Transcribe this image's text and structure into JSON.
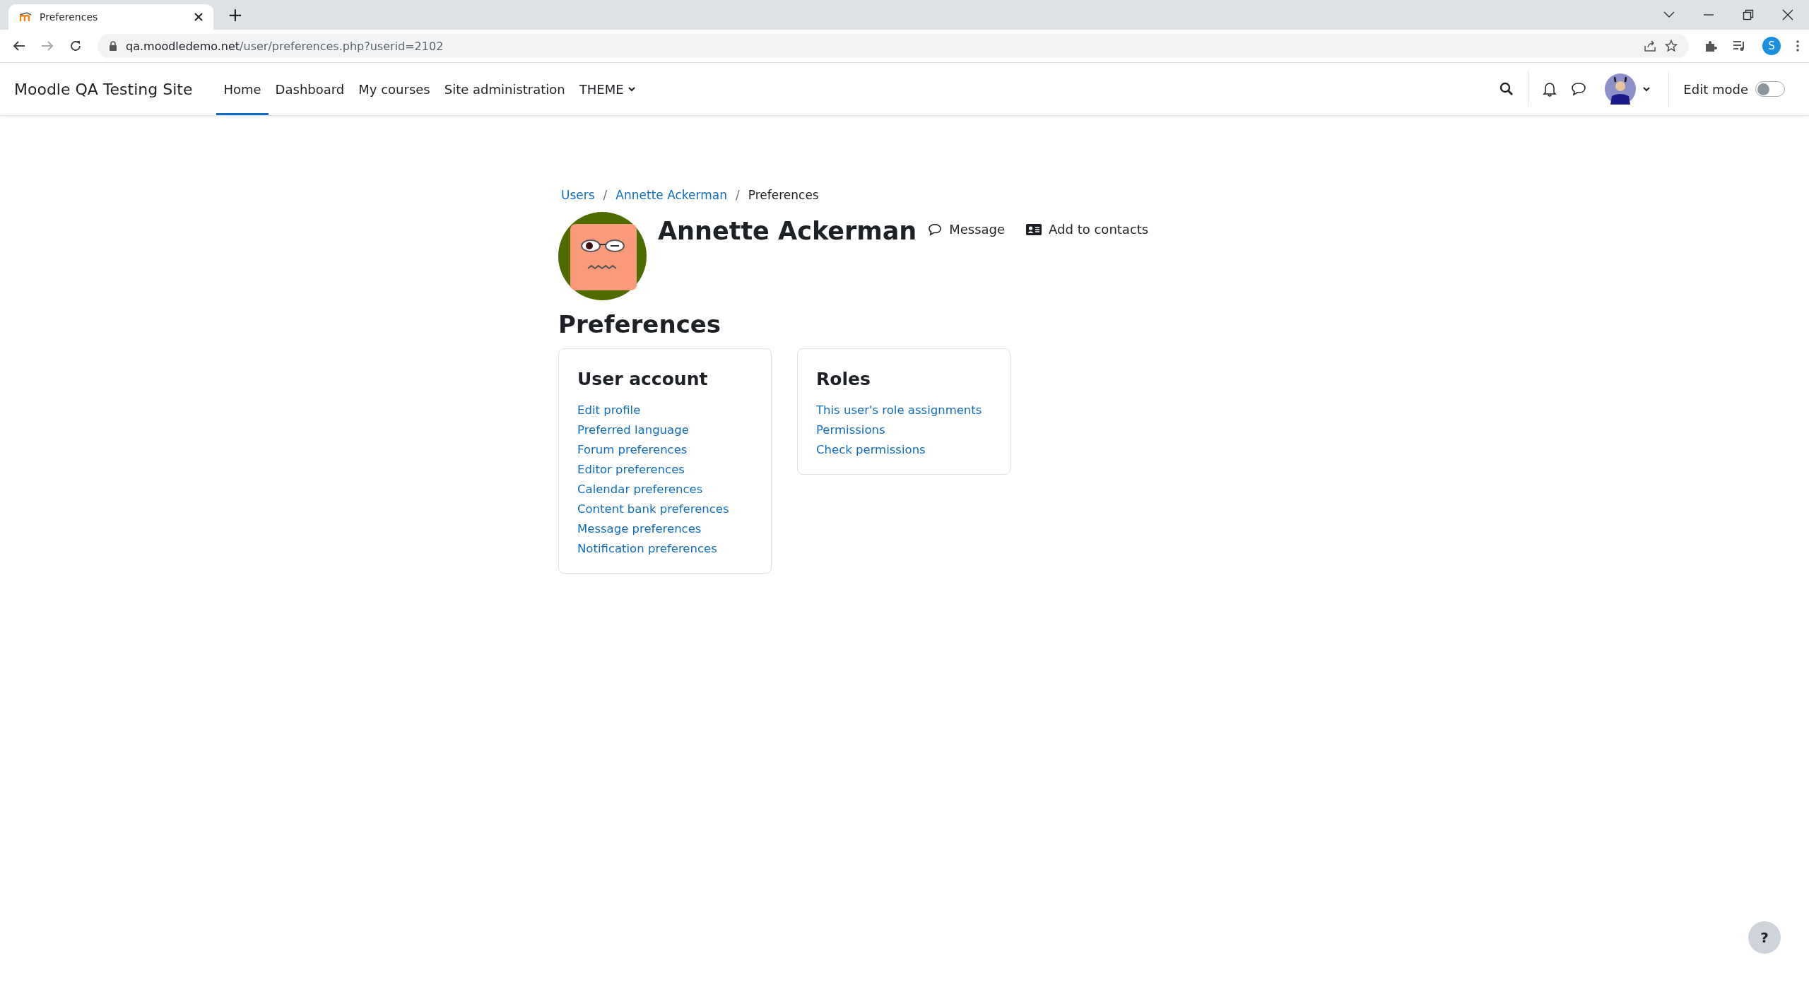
{
  "browser": {
    "tab": {
      "title": "Preferences"
    },
    "new_tab": "+",
    "url": {
      "host": "qa.moodledemo.net",
      "path": "/user/preferences.php?userid=2102"
    },
    "profile_initial": "S"
  },
  "navbar": {
    "site_name": "Moodle QA Testing Site",
    "items": [
      {
        "label": "Home",
        "selected": true,
        "dropdown": false
      },
      {
        "label": "Dashboard",
        "selected": false,
        "dropdown": false
      },
      {
        "label": "My courses",
        "selected": false,
        "dropdown": false
      },
      {
        "label": "Site administration",
        "selected": false,
        "dropdown": false
      },
      {
        "label": "THEME",
        "selected": false,
        "dropdown": true
      }
    ],
    "edit_mode": {
      "label": "Edit mode",
      "on": false
    }
  },
  "breadcrumb": [
    {
      "label": "Users",
      "link": true
    },
    {
      "separator": "/",
      "label": "Annette Ackerman",
      "link": true
    },
    {
      "separator": "/",
      "label": "Preferences",
      "link": false
    }
  ],
  "profile": {
    "name": "Annette Ackerman",
    "actions": [
      {
        "kind": "message",
        "label": "Message"
      },
      {
        "kind": "contact",
        "label": "Add to contacts"
      }
    ]
  },
  "page_title": "Preferences",
  "cards": [
    {
      "title": "User account",
      "links": [
        "Edit profile",
        "Preferred language",
        "Forum preferences",
        "Editor preferences",
        "Calendar preferences",
        "Content bank preferences",
        "Message preferences",
        "Notification preferences"
      ]
    },
    {
      "title": "Roles",
      "links": [
        "This user's role assignments",
        "Permissions",
        "Check permissions"
      ]
    }
  ],
  "help_button": "?"
}
